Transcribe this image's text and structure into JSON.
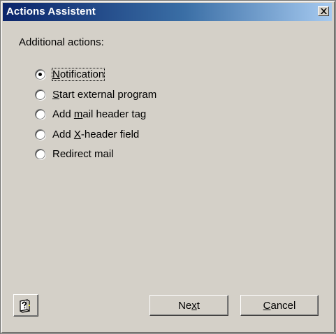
{
  "window": {
    "title": "Actions Assistent",
    "title_color": "#ffffff",
    "titlebar_start": "#0a246a",
    "titlebar_end": "#a6caf0",
    "face_color": "#d4d0c8"
  },
  "content": {
    "label": "Additional actions:",
    "options": [
      {
        "pre": "",
        "key": "N",
        "post": "otification",
        "selected": true
      },
      {
        "pre": "",
        "key": "S",
        "post": "tart external program",
        "selected": false
      },
      {
        "pre": "Add ",
        "key": "m",
        "post": "ail header tag",
        "selected": false
      },
      {
        "pre": "Add ",
        "key": "X",
        "post": "-header field",
        "selected": false
      },
      {
        "pre": "Redirect mail",
        "key": "",
        "post": "",
        "selected": false
      }
    ]
  },
  "buttons": {
    "help_icon": "help-book-icon",
    "next": {
      "pre": "Ne",
      "key": "x",
      "post": "t"
    },
    "cancel": {
      "pre": "",
      "key": "C",
      "post": "ancel"
    },
    "close_icon": "close-icon"
  }
}
